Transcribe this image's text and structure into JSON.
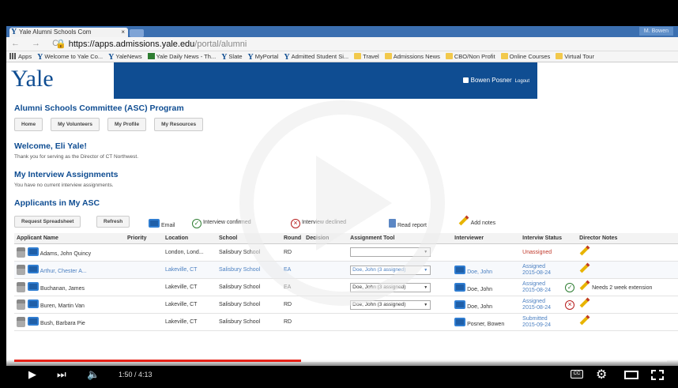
{
  "browser": {
    "tab_title": "Yale Alumni Schools Com",
    "tab_close": "×",
    "user_chip": "M. Bowen",
    "nav_glyphs": "← → C",
    "url_scheme_host": "https://apps.admissions.yale.edu",
    "url_path": "/portal/alumni",
    "bookmarks": [
      {
        "icon": "apps-icon",
        "label": "Apps"
      },
      {
        "icon": "yale-icon",
        "label": "Welcome to Yale Co..."
      },
      {
        "icon": "yale-icon",
        "label": "YaleNews"
      },
      {
        "icon": "news-icon",
        "label": "Yale Daily News - Th..."
      },
      {
        "icon": "yale-icon",
        "label": "Slate"
      },
      {
        "icon": "yale-icon",
        "label": "MyPortal"
      },
      {
        "icon": "yale-icon",
        "label": "Admitted Student Si..."
      },
      {
        "icon": "folder-icon",
        "label": "Travel"
      },
      {
        "icon": "folder-icon",
        "label": "Admissions News"
      },
      {
        "icon": "folder-icon",
        "label": "CBO/Non Profit"
      },
      {
        "icon": "folder-icon",
        "label": "Online Courses"
      },
      {
        "icon": "folder-icon",
        "label": "Virtual Tour"
      }
    ]
  },
  "header": {
    "logo": "Yale",
    "user_name": "Bowen Posner",
    "logout": "Logout"
  },
  "program": {
    "title": "Alumni Schools Committee (ASC) Program",
    "nav": [
      "Home",
      "My Volunteers",
      "My Profile",
      "My Resources"
    ]
  },
  "welcome": {
    "title": "Welcome, Eli Yale!",
    "text": "Thank you for serving as the Director of CT Northwest."
  },
  "assignments": {
    "title": "My Interview Assignments",
    "text": "You have no current interview assignments."
  },
  "applicants": {
    "title": "Applicants in My ASC",
    "buttons": {
      "request": "Request Spreadsheet",
      "refresh": "Refresh"
    },
    "legend": {
      "email": "Email",
      "confirmed": "Interview confirmed",
      "declined": "Interview declined",
      "report": "Read report",
      "notes": "Add notes"
    },
    "columns": [
      "Applicant Name",
      "Priority",
      "Location",
      "School",
      "Round",
      "Decision",
      "Assignment Tool",
      "Interviewer",
      "Interviw Status",
      "Director Notes"
    ],
    "rows": [
      {
        "name": "Adams, John Quincy",
        "location": "London, Lond...",
        "school": "Salisbury School",
        "round": "RD",
        "assignment": "",
        "interviewer": "",
        "status1": "Unassigned",
        "status2": "",
        "note": ""
      },
      {
        "name": "Arthur, Chester A...",
        "location": "Lakeville, CT",
        "school": "Salisbury School",
        "round": "EA",
        "assignment": "Doe, John (3 assigned)",
        "interviewer": "Doe, John",
        "status1": "Assigned",
        "status2": "2015-08-24",
        "note": ""
      },
      {
        "name": "Buchanan, James",
        "location": "Lakeville, CT",
        "school": "Salisbury School",
        "round": "EA",
        "assignment": "Doe, John (3 assigned)",
        "interviewer": "Doe, John",
        "status1": "Assigned",
        "status2": "2015-08-24",
        "note": "Needs 2 week extension"
      },
      {
        "name": "Buren, Martin Van",
        "location": "Lakeville, CT",
        "school": "Salisbury School",
        "round": "RD",
        "assignment": "Doe, John (3 assigned)",
        "interviewer": "Doe, John",
        "status1": "Assigned",
        "status2": "2015-08-24",
        "note": ""
      },
      {
        "name": "Bush, Barbara Pie",
        "location": "Lakeville, CT",
        "school": "Salisbury School",
        "round": "RD",
        "assignment": "",
        "interviewer": "Posner, Bowen",
        "status1": "Submitted",
        "status2": "2015-09-24",
        "note": ""
      }
    ]
  },
  "video": {
    "time": "1:50 / 4:13",
    "played_fraction": 0.44,
    "loaded_fraction": 0.56,
    "cc": "CC"
  }
}
